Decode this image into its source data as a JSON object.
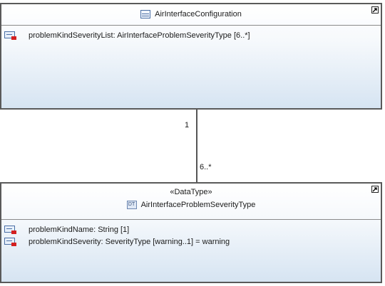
{
  "top_class": {
    "name": "AirInterfaceConfiguration",
    "attributes": [
      {
        "text": "problemKindSeverityList: AirInterfaceProblemSeverityType [6..*]"
      }
    ]
  },
  "association": {
    "multiplicity_top": "1",
    "multiplicity_bottom": "6..*"
  },
  "bottom_class": {
    "stereotype": "«DataType»",
    "name": "AirInterfaceProblemSeverityType",
    "attributes": [
      {
        "text": "problemKindName: String [1]"
      },
      {
        "text": "problemKindSeverity: SeverityType [warning..1] = warning"
      }
    ]
  },
  "icons": {
    "class_icon": "class-icon",
    "datatype_icon": "datatype-icon",
    "attribute_icon": "attribute-icon",
    "collapse_icon": "collapse-icon"
  }
}
